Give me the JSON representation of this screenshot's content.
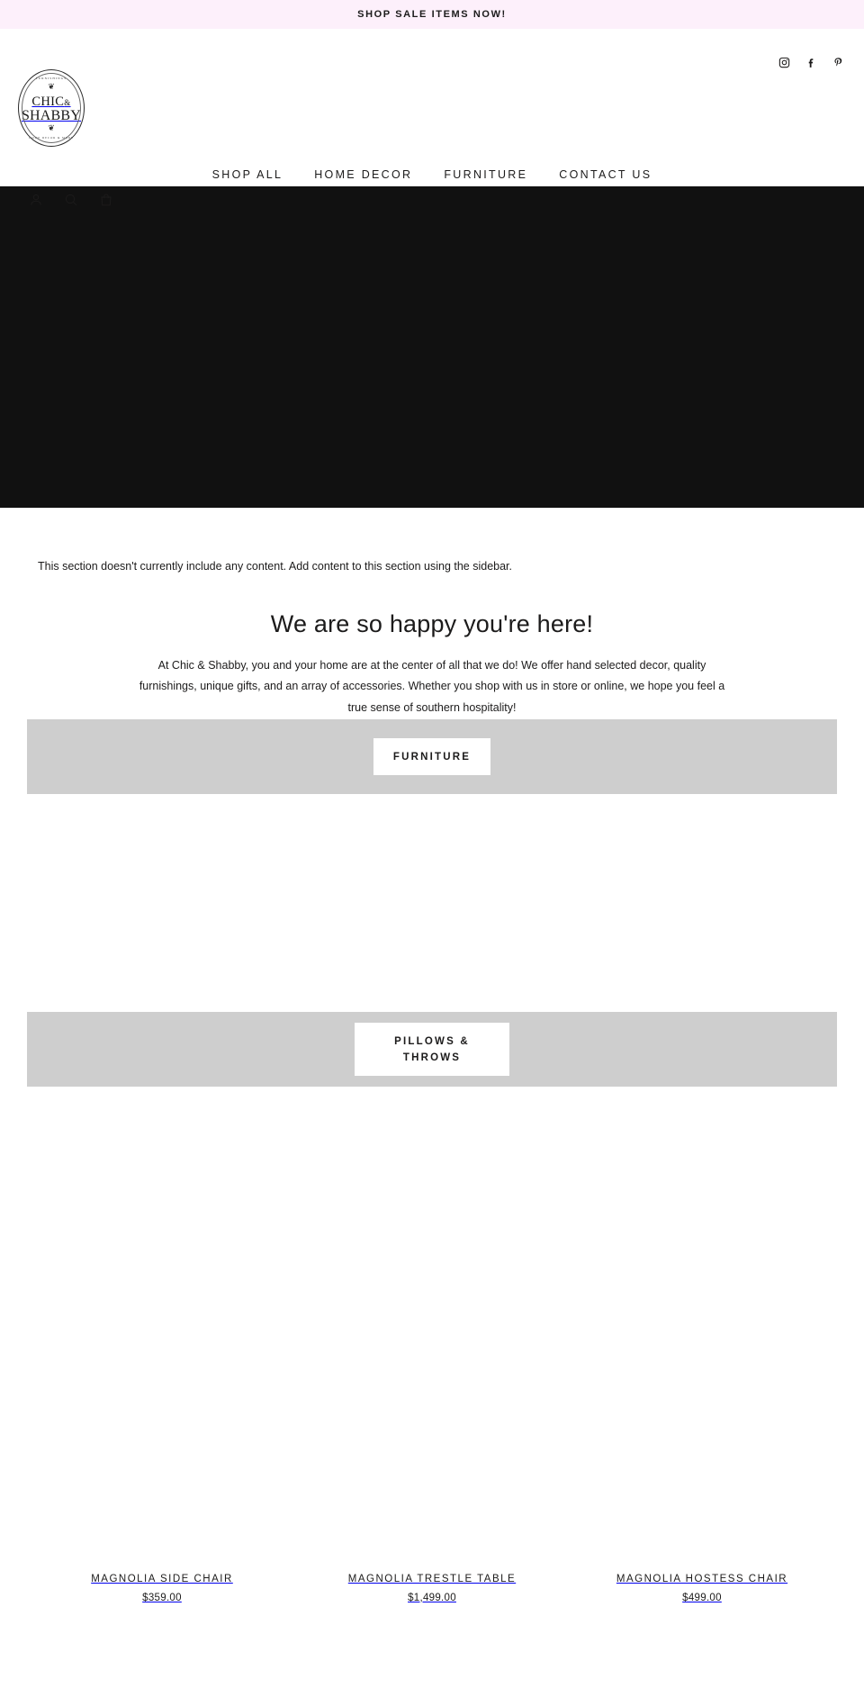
{
  "announcement": {
    "text": "SHOP SALE ITEMS NOW!",
    "background": "#fdf0fb"
  },
  "header": {
    "logo": {
      "top_arc_text": "FURNISHINGS",
      "line1": "CHIC",
      "ampersand": "&",
      "line2": "SHABBY",
      "bottom_arc_text": "HOME DECOR & MORE",
      "sprig_top": "❦",
      "sprig_bottom": "❦"
    },
    "social": [
      {
        "name": "instagram-icon",
        "label": "Instagram"
      },
      {
        "name": "facebook-icon",
        "label": "Facebook"
      },
      {
        "name": "pinterest-icon",
        "label": "Pinterest"
      }
    ],
    "nav": [
      {
        "label": "SHOP ALL"
      },
      {
        "label": "HOME DECOR"
      },
      {
        "label": "FURNITURE"
      },
      {
        "label": "CONTACT US"
      }
    ],
    "utility": [
      {
        "name": "account-icon",
        "label": "Account"
      },
      {
        "name": "search-icon",
        "label": "Search"
      },
      {
        "name": "cart-icon",
        "label": "Cart"
      }
    ]
  },
  "hero": {
    "background": "#111111"
  },
  "sections": {
    "empty_notice": "This section doesn't currently include any content. Add content to this section using the sidebar.",
    "welcome_title": "We are so happy you're here!",
    "welcome_body": "At Chic & Shabby, you and your home are at the center of all that we do! We offer hand selected decor, quality furnishings, unique gifts, and an array of accessories. Whether you shop with us in store or online, we hope you feel a true sense of southern hospitality!"
  },
  "collections": [
    {
      "label": "FURNITURE",
      "band_color": "#cecece"
    },
    {
      "label": "PILLOWS &\nTHROWS",
      "band_color": "#cecece"
    }
  ],
  "products": [
    {
      "title": "MAGNOLIA SIDE CHAIR",
      "price": "$359.00"
    },
    {
      "title": "MAGNOLIA TRESTLE TABLE",
      "price": "$1,499.00"
    },
    {
      "title": "MAGNOLIA HOSTESS CHAIR",
      "price": "$499.00"
    }
  ]
}
